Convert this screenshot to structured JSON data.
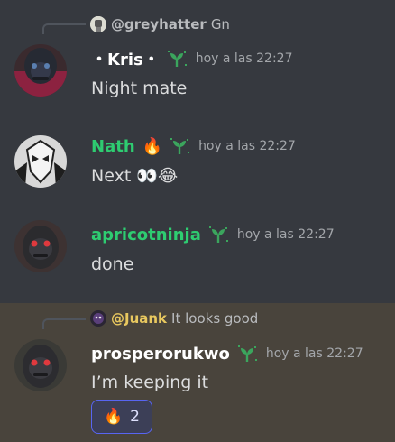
{
  "colors": {
    "background": "#36393f",
    "highlight_background": "#49443c",
    "username_default": "#ffffff",
    "username_green": "#2ecc71",
    "timestamp": "#a3a6aa",
    "mention": "#e8c85f",
    "reaction_border": "#5865f2"
  },
  "messages": [
    {
      "reply": {
        "author": "@greyhatter",
        "text": "Gn"
      },
      "author": "・Kris・",
      "badge_icon": "leaf-sprout-icon",
      "timestamp": "hoy a las 22:27",
      "content": "Night mate"
    },
    {
      "author": "Nath",
      "author_emoji": "🔥",
      "badge_icon": "leaf-sprout-icon",
      "timestamp": "hoy a las 22:27",
      "content": "Next 👀😂"
    },
    {
      "author": "apricotninja",
      "badge_icon": "leaf-sprout-icon",
      "timestamp": "hoy a las 22:27",
      "content": "done"
    },
    {
      "highlighted": true,
      "reply": {
        "author": "@Juank",
        "text": "It looks good"
      },
      "author": "prosperorukwo",
      "badge_icon": "leaf-sprout-icon",
      "timestamp": "hoy a las 22:27",
      "content": "I’m keeping it",
      "reaction": {
        "emoji": "🔥",
        "count": "2"
      }
    }
  ]
}
